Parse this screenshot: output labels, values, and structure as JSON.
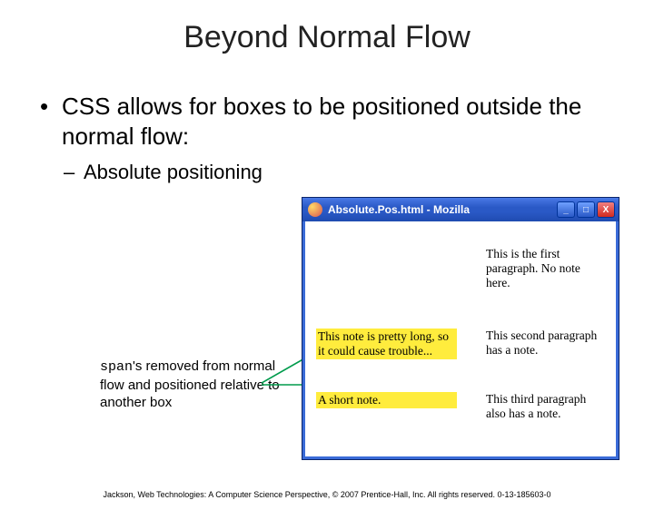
{
  "title": "Beyond Normal Flow",
  "bullets": {
    "l1": "CSS allows for boxes to be positioned outside the normal flow:",
    "l2": "Absolute positioning"
  },
  "callout": {
    "spanWord": "span",
    "rest": "'s removed from normal flow and positioned relative to another box"
  },
  "window": {
    "title": "Absolute.Pos.html - Mozilla",
    "buttons": {
      "min": "_",
      "max": "□",
      "close": "X"
    },
    "paragraphs": {
      "p1": "This is the first paragraph. No note here.",
      "p2": "This second paragraph has a note.",
      "p3": "This third paragraph also has a note."
    },
    "notes": {
      "n1": "This note is pretty long, so it could cause trouble...",
      "n2": "A short note."
    }
  },
  "footer": "Jackson, Web Technologies: A Computer Science Perspective, © 2007 Prentice-Hall, Inc. All rights reserved. 0-13-185603-0"
}
